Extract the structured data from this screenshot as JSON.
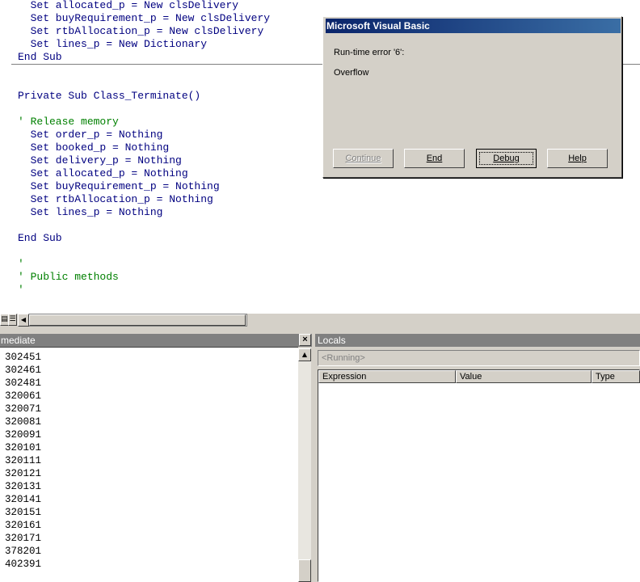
{
  "code_lines": [
    {
      "text": "  Set allocated_p = New clsDelivery",
      "kind": "code"
    },
    {
      "text": "  Set buyRequirement_p = New clsDelivery",
      "kind": "code"
    },
    {
      "text": "  Set rtbAllocation_p = New clsDelivery",
      "kind": "code"
    },
    {
      "text": "  Set lines_p = New Dictionary",
      "kind": "code"
    },
    {
      "text": "End Sub",
      "kind": "code"
    },
    {
      "text": "",
      "kind": "code"
    },
    {
      "text": "",
      "kind": "code"
    },
    {
      "text": "Private Sub Class_Terminate()",
      "kind": "code"
    },
    {
      "text": "",
      "kind": "code"
    },
    {
      "text": "' Release memory",
      "kind": "comment"
    },
    {
      "text": "  Set order_p = Nothing",
      "kind": "code"
    },
    {
      "text": "  Set booked_p = Nothing",
      "kind": "code"
    },
    {
      "text": "  Set delivery_p = Nothing",
      "kind": "code"
    },
    {
      "text": "  Set allocated_p = Nothing",
      "kind": "code"
    },
    {
      "text": "  Set buyRequirement_p = Nothing",
      "kind": "code"
    },
    {
      "text": "  Set rtbAllocation_p = Nothing",
      "kind": "code"
    },
    {
      "text": "  Set lines_p = Nothing",
      "kind": "code"
    },
    {
      "text": "",
      "kind": "code"
    },
    {
      "text": "End Sub",
      "kind": "code"
    },
    {
      "text": "",
      "kind": "code"
    },
    {
      "text": "'",
      "kind": "comment"
    },
    {
      "text": "' Public methods",
      "kind": "comment"
    },
    {
      "text": "'",
      "kind": "comment"
    }
  ],
  "immediate": {
    "title": "mediate",
    "close_glyph": "×",
    "lines": [
      "302451",
      "302461",
      "302481",
      "320061",
      "320071",
      "320081",
      "320091",
      "320101",
      "320111",
      "320121",
      "320131",
      "320141",
      "320151",
      "320161",
      "320171",
      "378201",
      "402391"
    ]
  },
  "locals": {
    "title": "Locals",
    "context": "<Running>",
    "columns": [
      "Expression",
      "Value",
      "Type"
    ]
  },
  "dialog": {
    "title": "Microsoft Visual Basic",
    "error_line": "Run-time error '6':",
    "message": "Overflow",
    "buttons": {
      "continue": "Continue",
      "end": "End",
      "debug": "Debug",
      "help": "Help"
    }
  },
  "icons": {
    "scroll_left": "◀",
    "scroll_up": "▲",
    "procedure_view": "▤",
    "full_module_view": "☰"
  },
  "colors": {
    "keyword": "#000080",
    "comment": "#008000",
    "title_bar_active": "#0a246a",
    "pane_title_inactive": "#808080"
  }
}
